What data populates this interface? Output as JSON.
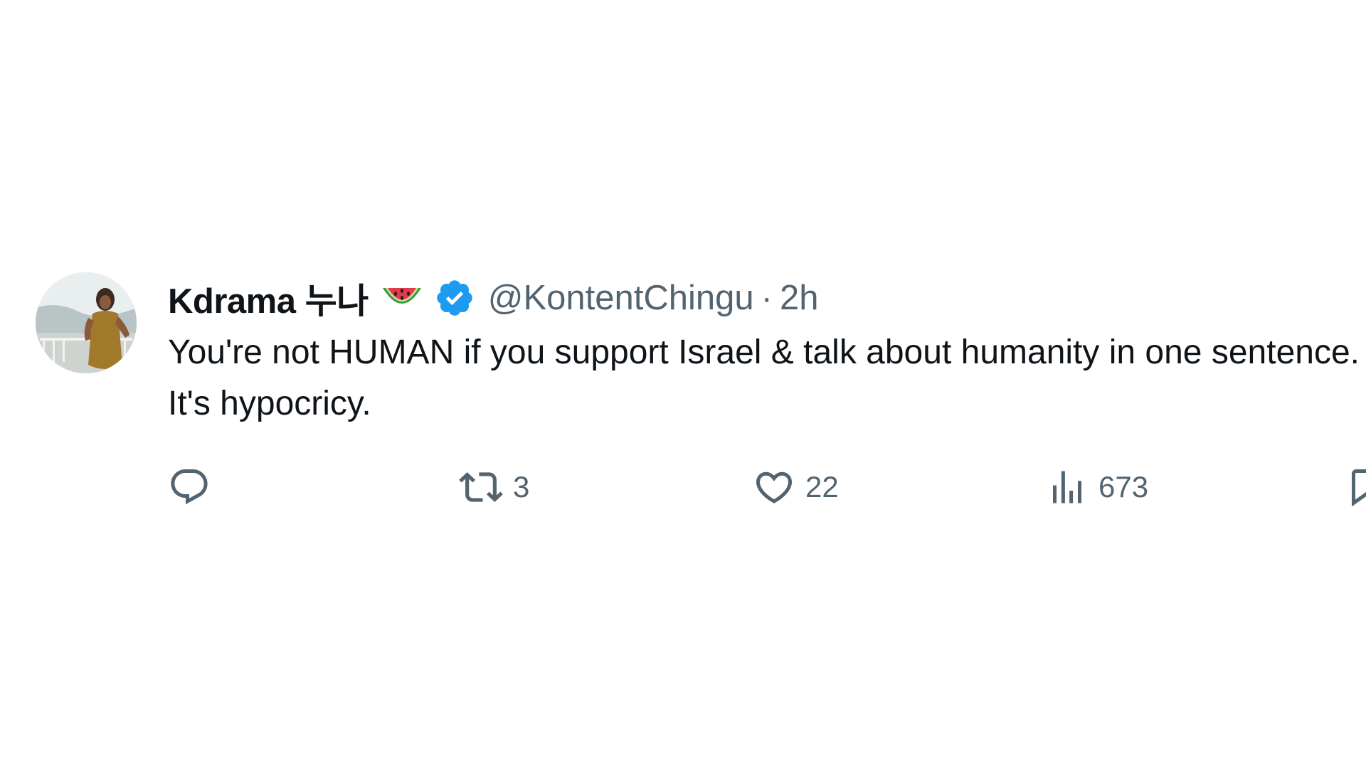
{
  "tweet": {
    "author": {
      "display_name": "Kdrama 누나",
      "emoji": "watermelon-emoji",
      "verified": true,
      "handle": "@KontentChingu",
      "separator": "·",
      "time": "2h"
    },
    "text": "You're not HUMAN if you support Israel & talk about humanity in one sentence. It's hypocricy.",
    "actions": {
      "reply": {
        "icon": "reply-icon"
      },
      "retweet": {
        "icon": "retweet-icon",
        "count": "3"
      },
      "like": {
        "icon": "heart-icon",
        "count": "22"
      },
      "views": {
        "icon": "views-icon",
        "count": "673"
      },
      "bookmark": {
        "icon": "bookmark-icon"
      }
    },
    "colors": {
      "text_primary": "#0f1419",
      "text_secondary": "#536471",
      "verified_blue": "#1d9bf0",
      "background": "#ffffff"
    }
  }
}
